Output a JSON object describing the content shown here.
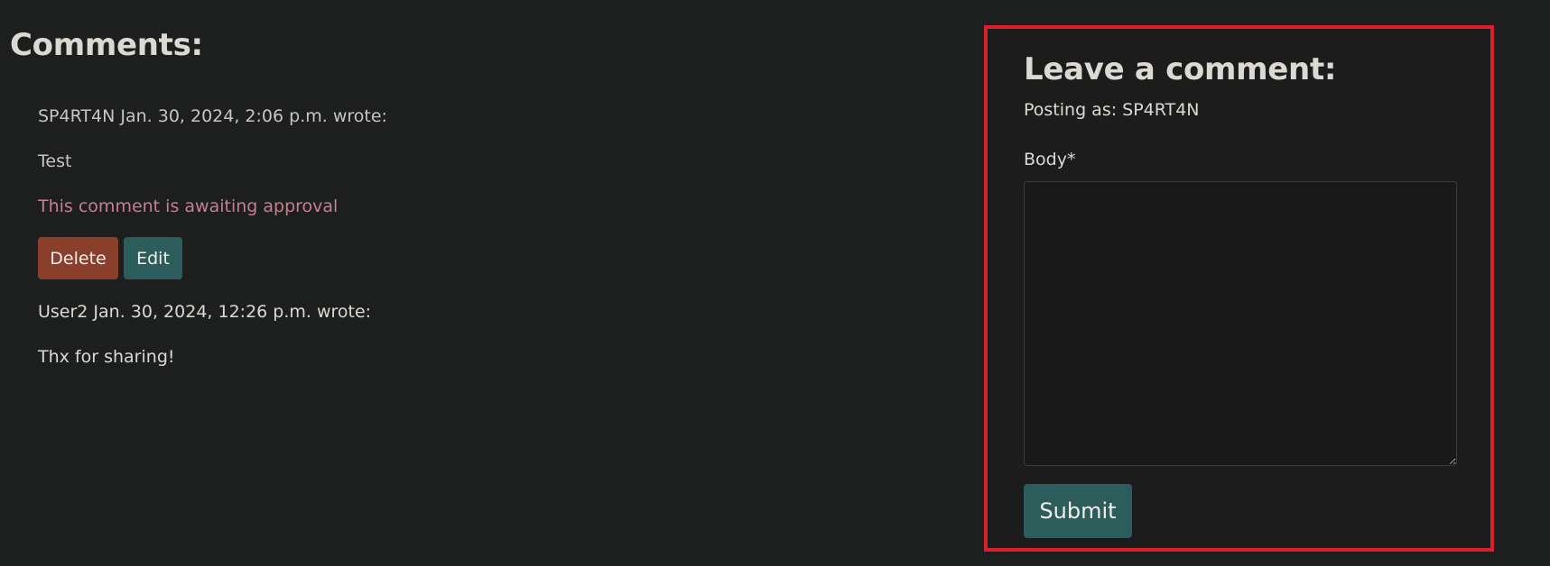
{
  "comments_section": {
    "title": "Comments:",
    "comments": [
      {
        "meta": "SP4RT4N Jan. 30, 2024, 2:06 p.m. wrote:",
        "body": "Test",
        "pending_notice": "This comment is awaiting approval",
        "delete_label": "Delete",
        "edit_label": "Edit"
      },
      {
        "meta": "User2 Jan. 30, 2024, 12:26 p.m. wrote:",
        "body": "Thx for sharing!"
      }
    ]
  },
  "comment_form": {
    "title": "Leave a comment:",
    "posting_as": "Posting as: SP4RT4N",
    "body_label": "Body*",
    "body_value": "",
    "submit_label": "Submit",
    "highlight_color": "#d9202c"
  },
  "colors": {
    "background": "#1d1f1e",
    "delete_button": "#8a3f2c",
    "primary_button": "#2d5d5a",
    "pending_text": "#c57f92"
  }
}
